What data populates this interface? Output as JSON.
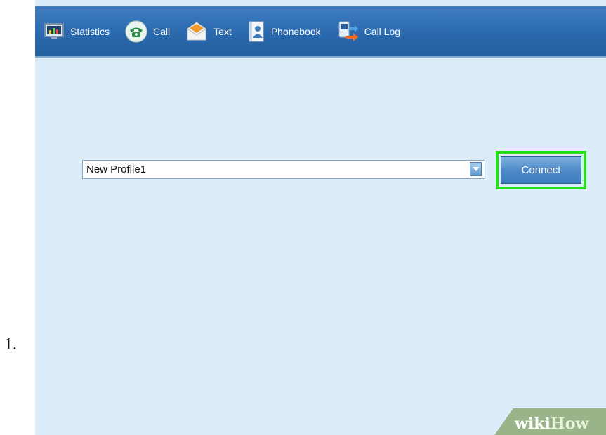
{
  "step": {
    "number": "1."
  },
  "toolbar": {
    "items": [
      {
        "label": "Statistics",
        "icon": "statistics-monitor-icon"
      },
      {
        "label": "Call",
        "icon": "phone-icon"
      },
      {
        "label": "Text",
        "icon": "envelope-icon"
      },
      {
        "label": "Phonebook",
        "icon": "contact-book-icon"
      },
      {
        "label": "Call Log",
        "icon": "call-log-icon"
      }
    ]
  },
  "profile": {
    "selected": "New Profile1"
  },
  "connect": {
    "label": "Connect"
  },
  "watermark": {
    "part1": "wiki",
    "part2": "How"
  },
  "colors": {
    "toolbar": "#2f6fb3",
    "background": "#dcedf9",
    "highlight": "#22e01b",
    "button": "#4f8bc8"
  }
}
